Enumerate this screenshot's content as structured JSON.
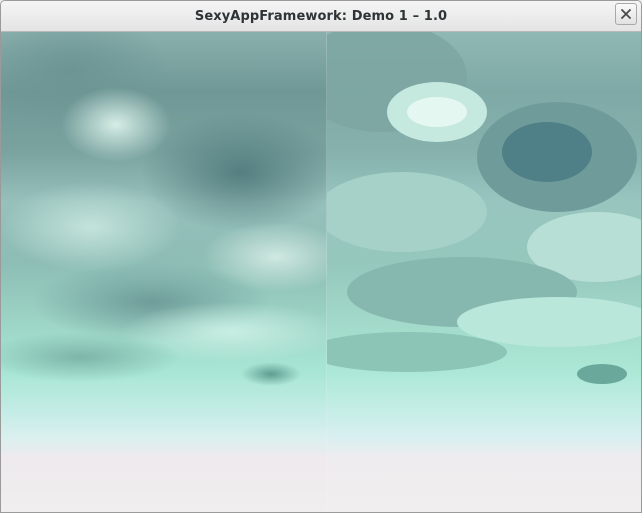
{
  "window": {
    "title": "SexyAppFramework: Demo 1 – 1.0",
    "close_icon": "close-icon"
  },
  "scene": {
    "description_icon": "sky-clouds",
    "colors": {
      "cloud_dark": "#5f8a8a",
      "cloud_light": "#dff5ef",
      "teal": "#9fe0cc",
      "horizon": "#d8f0f0",
      "ground": "#f0eeef"
    }
  }
}
